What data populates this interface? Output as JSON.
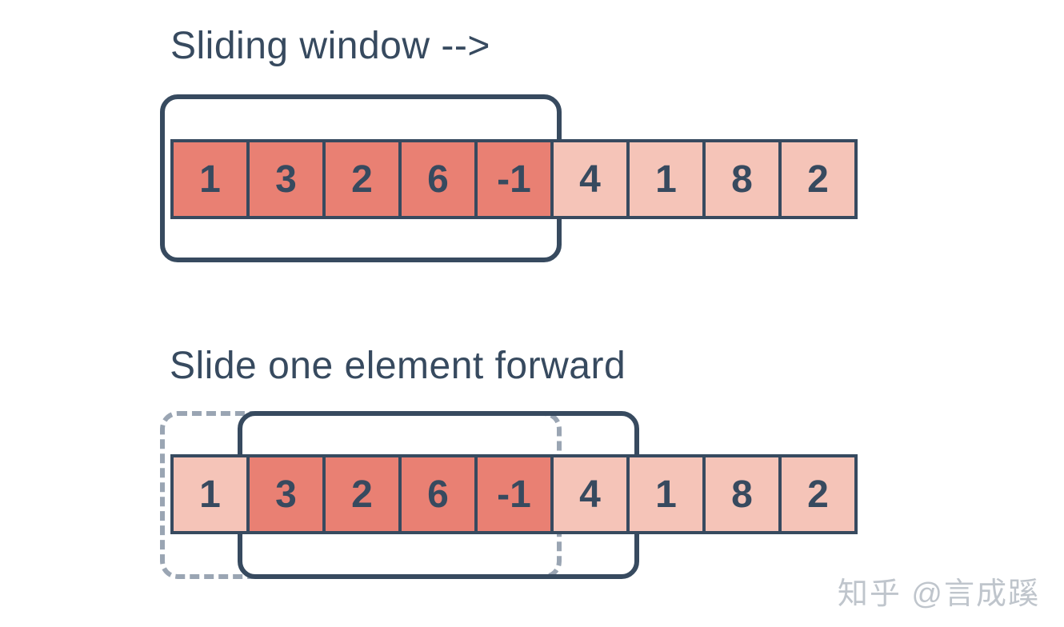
{
  "diagram": {
    "title1": "Sliding window -->",
    "title2": "Slide one element forward",
    "cells": [
      "1",
      "3",
      "2",
      "6",
      "-1",
      "4",
      "1",
      "8",
      "2"
    ],
    "row1_in": [
      true,
      true,
      true,
      true,
      true,
      false,
      false,
      false,
      false
    ],
    "row2_in": [
      false,
      true,
      true,
      true,
      true,
      false,
      false,
      false,
      false
    ],
    "watermark": "知乎 @言成蹊"
  },
  "colors": {
    "frame": "#374a5f",
    "cell_in": "#e98073",
    "cell_out": "#f5c4b8"
  }
}
